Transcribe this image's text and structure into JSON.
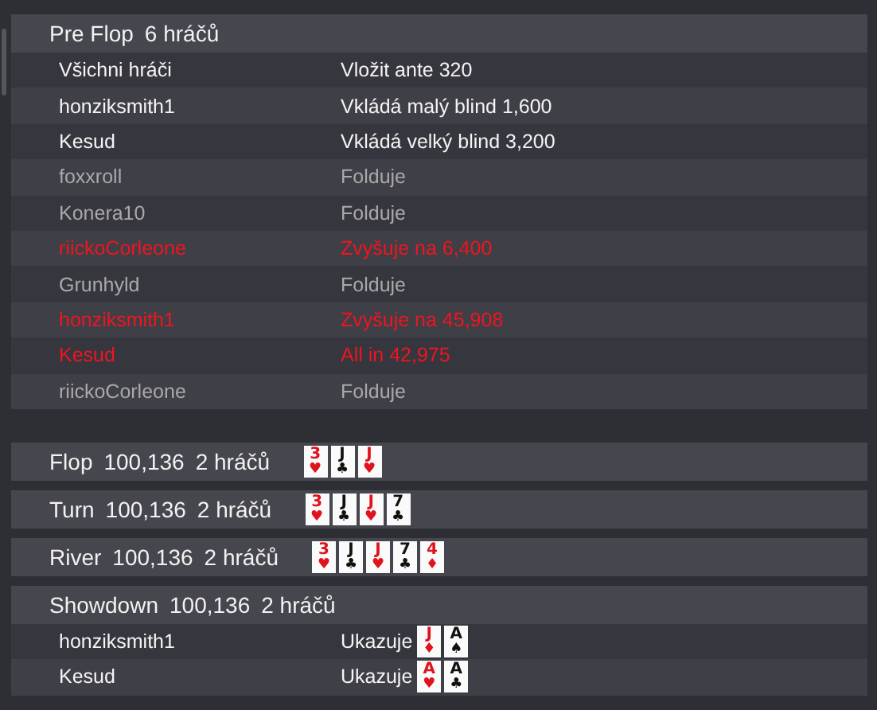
{
  "sections": [
    {
      "street": "Pre Flop",
      "players": "6 hráčů",
      "rows": [
        {
          "player": "Všichni hráči",
          "action": "Vložit ante 320",
          "kind": "normal"
        },
        {
          "player": "honziksmith1",
          "action": "Vkládá malý blind 1,600",
          "kind": "normal"
        },
        {
          "player": "Kesud",
          "action": "Vkládá velký blind 3,200",
          "kind": "normal"
        },
        {
          "player": "foxxroll",
          "action": "Folduje",
          "kind": "fold"
        },
        {
          "player": "Konera10",
          "action": "Folduje",
          "kind": "fold"
        },
        {
          "player": "riickoCorleone",
          "action": "Zvyšuje na 6,400",
          "kind": "raise"
        },
        {
          "player": "Grunhyld",
          "action": "Folduje",
          "kind": "fold"
        },
        {
          "player": "honziksmith1",
          "action": "Zvyšuje na 45,908",
          "kind": "raise"
        },
        {
          "player": "Kesud",
          "action": "All in 42,975",
          "kind": "raise"
        },
        {
          "player": "riickoCorleone",
          "action": "Folduje",
          "kind": "fold"
        }
      ]
    },
    {
      "street": "Flop",
      "pot": "100,136",
      "players": "2 hráčů",
      "cards": [
        {
          "rank": "3",
          "suit": "♥",
          "color": "#e0121c"
        },
        {
          "rank": "J",
          "suit": "♣",
          "color": "#111111"
        },
        {
          "rank": "J",
          "suit": "♥",
          "color": "#e0121c"
        }
      ]
    },
    {
      "street": "Turn",
      "pot": "100,136",
      "players": "2 hráčů",
      "cards": [
        {
          "rank": "3",
          "suit": "♥",
          "color": "#e0121c"
        },
        {
          "rank": "J",
          "suit": "♣",
          "color": "#111111"
        },
        {
          "rank": "J",
          "suit": "♥",
          "color": "#e0121c"
        },
        {
          "rank": "7",
          "suit": "♣",
          "color": "#111111"
        }
      ]
    },
    {
      "street": "River",
      "pot": "100,136",
      "players": "2 hráčů",
      "cards": [
        {
          "rank": "3",
          "suit": "♥",
          "color": "#e0121c"
        },
        {
          "rank": "J",
          "suit": "♣",
          "color": "#111111"
        },
        {
          "rank": "J",
          "suit": "♥",
          "color": "#e0121c"
        },
        {
          "rank": "7",
          "suit": "♣",
          "color": "#111111"
        },
        {
          "rank": "4",
          "suit": "♦",
          "color": "#e0121c"
        }
      ]
    },
    {
      "street": "Showdown",
      "pot": "100,136",
      "players": "2 hráčů",
      "rows": [
        {
          "player": "honziksmith1",
          "action": "Ukazuje",
          "kind": "normal",
          "cards": [
            {
              "rank": "J",
              "suit": "♦",
              "color": "#e0121c"
            },
            {
              "rank": "A",
              "suit": "♠",
              "color": "#111111"
            }
          ]
        },
        {
          "player": "Kesud",
          "action": "Ukazuje",
          "kind": "normal",
          "cards": [
            {
              "rank": "A",
              "suit": "♥",
              "color": "#e0121c"
            },
            {
              "rank": "A",
              "suit": "♣",
              "color": "#111111"
            }
          ]
        }
      ]
    }
  ]
}
